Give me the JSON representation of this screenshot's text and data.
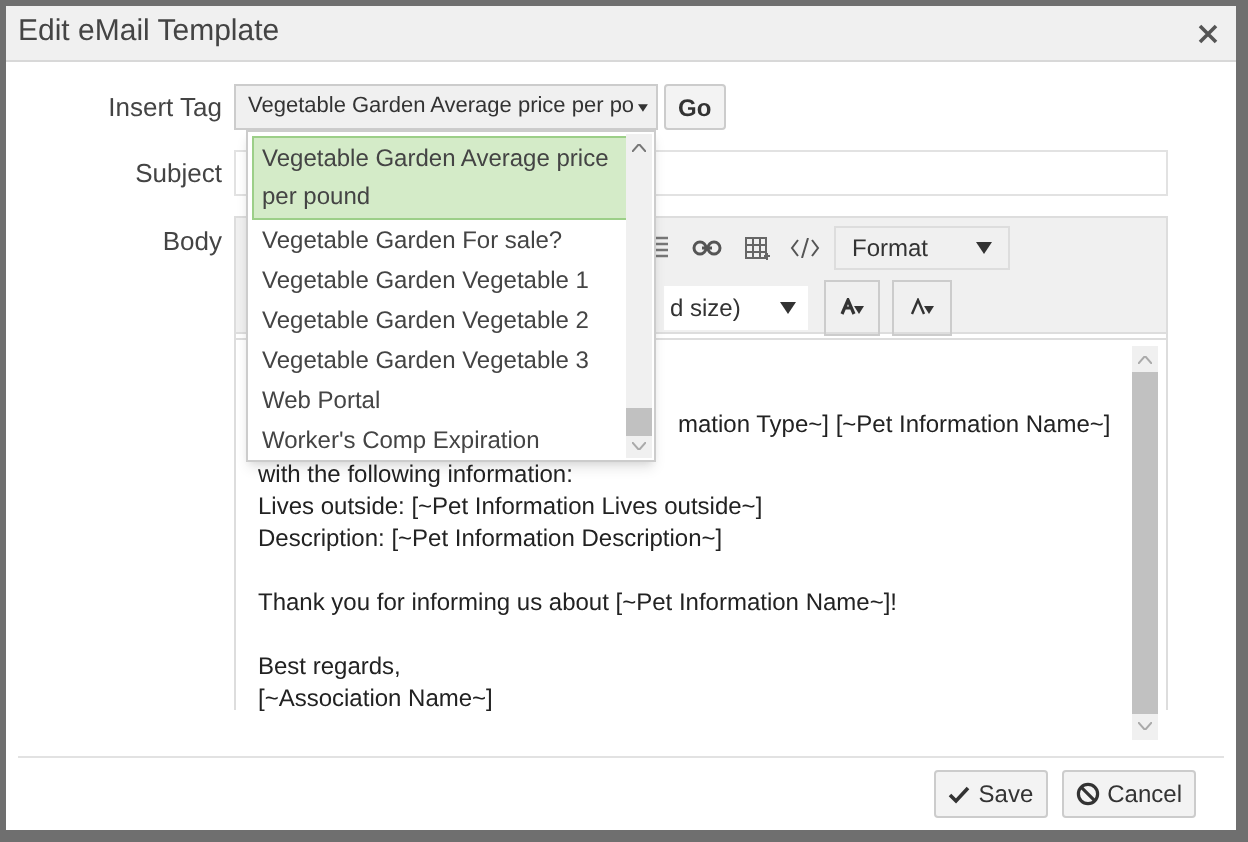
{
  "dialog": {
    "title": "Edit eMail Template"
  },
  "insert_tag": {
    "label": "Insert Tag",
    "value": "Vegetable Garden Average price per po",
    "go": "Go",
    "expanded": true,
    "options": [
      {
        "label": "Vegetable Garden Average price per pound",
        "selected": true
      },
      {
        "label": "Vegetable Garden For sale?",
        "selected": false
      },
      {
        "label": "Vegetable Garden Vegetable 1",
        "selected": false
      },
      {
        "label": "Vegetable Garden Vegetable 2",
        "selected": false
      },
      {
        "label": "Vegetable Garden Vegetable 3",
        "selected": false
      },
      {
        "label": "Web Portal",
        "selected": false
      },
      {
        "label": "Worker's Comp Expiration",
        "selected": false
      }
    ]
  },
  "subject": {
    "label": "Subject"
  },
  "body": {
    "label": "Body",
    "format": "Format",
    "font_size": "d size)",
    "paragraphs": [
      [
        "mation Type~] [~Pet Information Name~]",
        "with the following information:",
        "Lives outside: [~Pet Information Lives outside~]",
        "Description: [~Pet Information Description~]"
      ],
      [
        "Thank you for informing us about [~Pet Information Name~]!"
      ],
      [
        "Best regards,",
        "[~Association Name~]"
      ]
    ]
  },
  "buttons": [
    {
      "label": "Save",
      "kind": "save"
    },
    {
      "label": "Cancel",
      "kind": "cancel"
    }
  ]
}
